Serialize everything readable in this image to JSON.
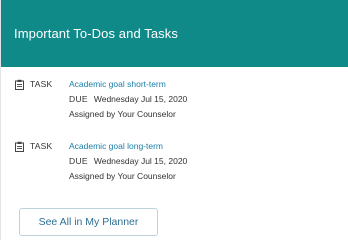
{
  "header": {
    "title": "Important To-Dos and Tasks"
  },
  "tasks": [
    {
      "type_label": "TASK",
      "type_icon": "task-clipboard-icon",
      "title": "Academic goal short-term",
      "due_label": "DUE",
      "due_date": "Wednesday Jul 15, 2020",
      "assigned": "Assigned by Your Counselor"
    },
    {
      "type_label": "TASK",
      "type_icon": "task-clipboard-icon",
      "title": "Academic goal long-term",
      "due_label": "DUE",
      "due_date": "Wednesday Jul 15, 2020",
      "assigned": "Assigned by Your Counselor"
    }
  ],
  "footer": {
    "planner_button_label": "See All in My Planner"
  },
  "colors": {
    "header_bg": "#0f8a88",
    "link": "#1a7ea8",
    "button_text": "#2d6f94",
    "button_border": "#bcd3de"
  }
}
